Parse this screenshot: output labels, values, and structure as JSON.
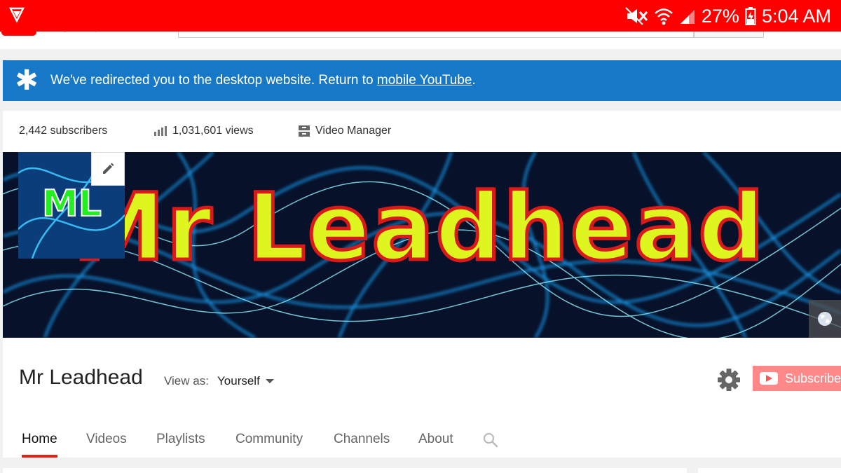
{
  "status_bar": {
    "battery": "27%",
    "time": "5:04 AM",
    "icons": [
      "app-notification-icon",
      "mute-icon",
      "wifi-icon",
      "signal-icon",
      "battery-charging-icon"
    ]
  },
  "header": {
    "brand": "Premium"
  },
  "banner": {
    "message": "We've redirected you to the desktop website. Return to ",
    "link": "mobile YouTube",
    "suffix": "."
  },
  "stats": {
    "subscribers": "2,442 subscribers",
    "views": "1,031,601 views",
    "video_manager": "Video Manager"
  },
  "channel_art": {
    "title": "Mr Leadhead",
    "avatar_text": "ML"
  },
  "channel": {
    "name": "Mr Leadhead",
    "view_as_label": "View as:",
    "view_as_value": "Yourself",
    "subscribe_label": "Subscribe"
  },
  "tabs": [
    {
      "label": "Home",
      "active": true
    },
    {
      "label": "Videos",
      "active": false
    },
    {
      "label": "Playlists",
      "active": false
    },
    {
      "label": "Community",
      "active": false
    },
    {
      "label": "Channels",
      "active": false
    },
    {
      "label": "About",
      "active": false
    }
  ],
  "colors": {
    "status_bar": "#ff0000",
    "banner": "#1878c8",
    "tab_active_underline": "#e62117",
    "subscribe": "#ff8888"
  }
}
